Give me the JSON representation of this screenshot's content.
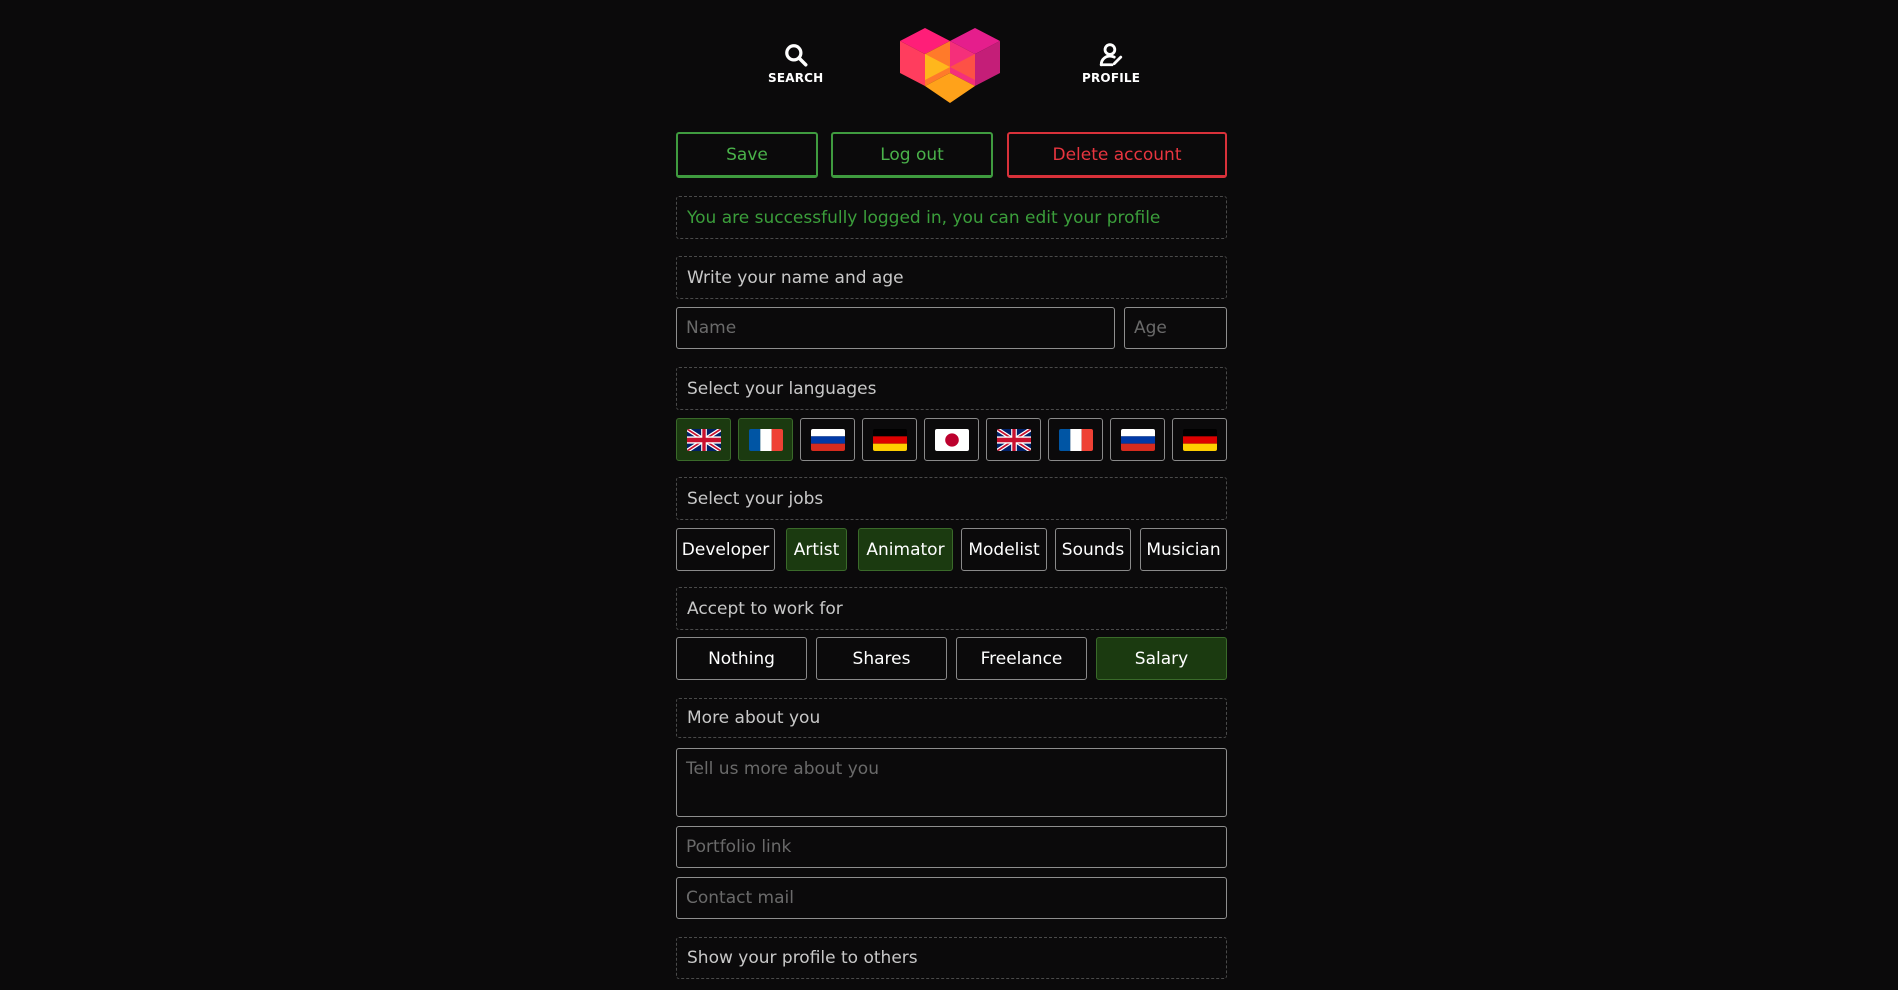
{
  "nav": {
    "search_label": "SEARCH",
    "profile_label": "PROFILE"
  },
  "actions": {
    "save": "Save",
    "logout": "Log out",
    "delete": "Delete account"
  },
  "status": {
    "message": "You are successfully logged in, you can edit your profile"
  },
  "name_section": {
    "label": "Write your name and age",
    "name_placeholder": "Name",
    "age_placeholder": "Age"
  },
  "languages": {
    "label": "Select your languages",
    "flags": [
      {
        "country": "uk",
        "selected": true
      },
      {
        "country": "france",
        "selected": true
      },
      {
        "country": "russia",
        "selected": false
      },
      {
        "country": "germany",
        "selected": false
      },
      {
        "country": "japan",
        "selected": false
      },
      {
        "country": "uk",
        "selected": false
      },
      {
        "country": "france",
        "selected": false
      },
      {
        "country": "russia",
        "selected": false
      },
      {
        "country": "germany",
        "selected": false
      }
    ]
  },
  "jobs": {
    "label": "Select your jobs",
    "items": [
      {
        "label": "Developer",
        "selected": false
      },
      {
        "label": "Artist",
        "selected": true
      },
      {
        "label": "Animator",
        "selected": true
      },
      {
        "label": "Modelist",
        "selected": false
      },
      {
        "label": "Sounds",
        "selected": false
      },
      {
        "label": "Musician",
        "selected": false
      }
    ]
  },
  "work": {
    "label": "Accept to work for",
    "items": [
      {
        "label": "Nothing",
        "selected": false
      },
      {
        "label": "Shares",
        "selected": false
      },
      {
        "label": "Freelance",
        "selected": false
      },
      {
        "label": "Salary",
        "selected": true
      }
    ]
  },
  "about": {
    "label": "More about you",
    "bio_placeholder": "Tell us more about you",
    "portfolio_placeholder": "Portfolio link",
    "mail_placeholder": "Contact mail"
  },
  "visibility": {
    "label": "Show your profile to others"
  },
  "colors": {
    "accent_green": "#4ab24a",
    "danger_red": "#e8353f",
    "selected_bg": "#1b3a10",
    "background": "#0b0a0b"
  }
}
